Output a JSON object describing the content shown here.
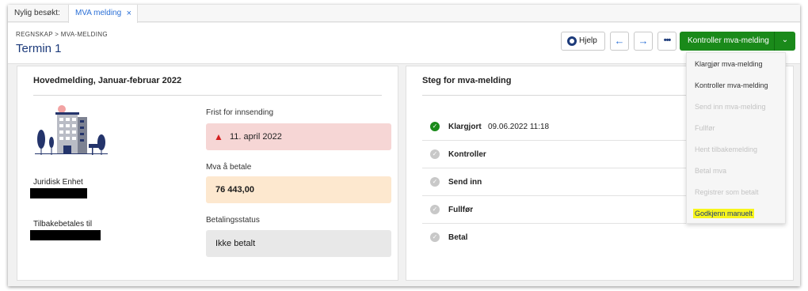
{
  "tabs": {
    "recent_label": "Nylig besøkt:",
    "active_label": "MVA melding",
    "close_glyph": "×"
  },
  "header": {
    "breadcrumb": "REGNSKAP > MVA-MELDING",
    "title": "Termin 1",
    "help_label": "Hjelp",
    "prev_glyph": "←",
    "next_glyph": "→",
    "more_glyph": "•••",
    "primary_label": "Kontroller mva-melding",
    "primary_chevron": "⌄"
  },
  "left_card": {
    "title": "Hovedmelding, Januar-februar 2022",
    "juridisk_label": "Juridisk Enhet",
    "tilbake_label": "Tilbakebetales til",
    "frist_label": "Frist for innsending",
    "frist_value": "11. april 2022",
    "mva_label": "Mva å betale",
    "mva_value": "76 443,00",
    "status_label": "Betalingsstatus",
    "status_value": "Ikke betalt"
  },
  "right_card": {
    "title": "Steg for mva-melding",
    "steps": [
      {
        "name": "Klargjort",
        "date": "09.06.2022 11:18",
        "done": true
      },
      {
        "name": "Kontroller",
        "date": "",
        "done": false
      },
      {
        "name": "Send inn",
        "date": "",
        "done": false
      },
      {
        "name": "Fullfør",
        "date": "",
        "done": false
      },
      {
        "name": "Betal",
        "date": "",
        "done": false
      }
    ]
  },
  "dropdown": {
    "items": [
      {
        "label": "Klargjør mva-melding",
        "enabled": true
      },
      {
        "label": "Kontroller mva-melding",
        "enabled": true
      },
      {
        "label": "Send inn mva-melding",
        "enabled": false
      },
      {
        "label": "Fullfør",
        "enabled": false
      },
      {
        "label": "Hent tilbakemelding",
        "enabled": false
      },
      {
        "label": "Betal mva",
        "enabled": false
      },
      {
        "label": "Registrer som betalt",
        "enabled": false
      },
      {
        "label": "Godkjenn manuelt",
        "enabled": true,
        "highlighted": true
      }
    ]
  },
  "colors": {
    "primary": "#1a8a1a",
    "accent": "#2a6fd6",
    "title": "#1c3a7a",
    "deadline_bg": "#f6d6d5",
    "amount_bg": "#fde8cf",
    "status_bg": "#e8e8e8",
    "highlight": "#f7f51c"
  },
  "icons": {
    "help": "lifebuoy-icon",
    "warning": "warning-triangle-icon",
    "done": "check-circle-icon",
    "pending": "grey-circle-icon"
  }
}
